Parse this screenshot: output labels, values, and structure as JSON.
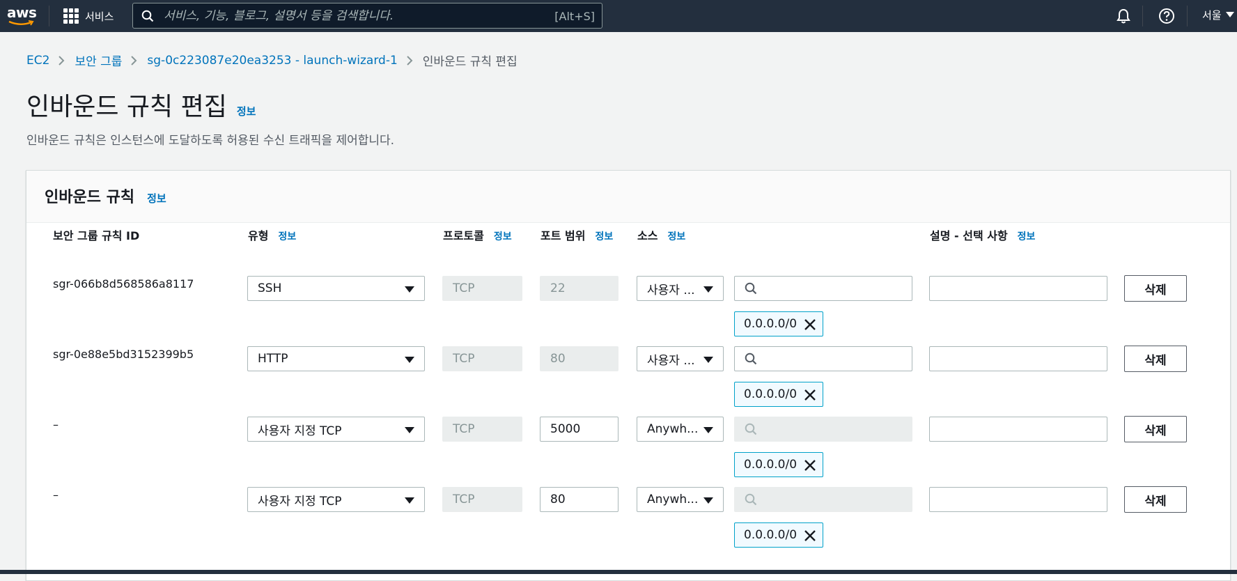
{
  "nav": {
    "logo": "aws",
    "services_label": "서비스",
    "search_placeholder": "서비스, 기능, 블로그, 설명서 등을 검색합니다.",
    "search_shortcut": "[Alt+S]",
    "region": "서울"
  },
  "breadcrumb": [
    "EC2",
    "보안 그룹",
    "sg-0c223087e20ea3253 - launch-wizard-1",
    "인바운드 규칙 편집"
  ],
  "page": {
    "title": "인바운드 규칙 편집",
    "info": "정보",
    "subtitle": "인바운드 규칙은 인스턴스에 도달하도록 허용된 수신 트래픽을 제어합니다."
  },
  "panel": {
    "title": "인바운드 규칙",
    "info": "정보",
    "columns": {
      "rule_id": "보안 그룹 규칙 ID",
      "type": "유형",
      "protocol": "프로토콜",
      "port": "포트 범위",
      "source": "소스",
      "description": "설명 - 선택 사항",
      "info": "정보"
    },
    "delete_label": "삭제",
    "rows": [
      {
        "id": "sgr-066b8d568586a8117",
        "type": "SSH",
        "protocol": "TCP",
        "port": "22",
        "source": "사용자 ...",
        "cidr": "0.0.0.0/0",
        "description": ""
      },
      {
        "id": "sgr-0e88e5bd3152399b5",
        "type": "HTTP",
        "protocol": "TCP",
        "port": "80",
        "source": "사용자 ...",
        "cidr": "0.0.0.0/0",
        "description": ""
      },
      {
        "id": "–",
        "type": "사용자 지정 TCP",
        "protocol": "TCP",
        "port": "5000",
        "source": "Anywh...",
        "cidr": "0.0.0.0/0",
        "description": ""
      },
      {
        "id": "–",
        "type": "사용자 지정 TCP",
        "protocol": "TCP",
        "port": "80",
        "source": "Anywh...",
        "cidr": "0.0.0.0/0",
        "description": ""
      }
    ]
  },
  "colors": {
    "nav_bg": "#232f3e",
    "link": "#0073bb",
    "token_border": "#00a1c9"
  }
}
